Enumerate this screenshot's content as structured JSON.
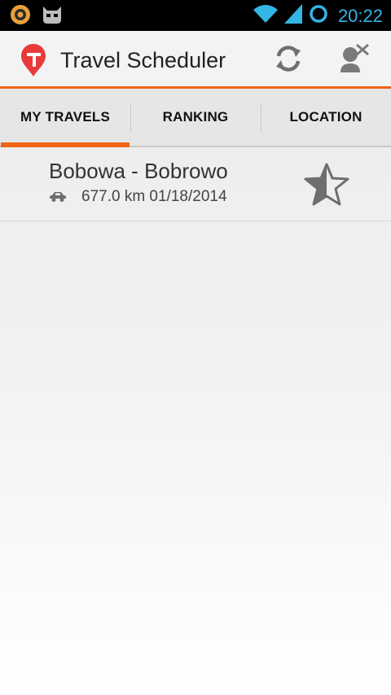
{
  "status_bar": {
    "time": "20:22",
    "icons": [
      "app-notification-icon",
      "cyanogen-mascot-icon",
      "wifi-icon",
      "signal-icon",
      "battery-ring-icon"
    ]
  },
  "action_bar": {
    "title": "Travel Scheduler",
    "logo_icon": "travel-pin-logo-icon",
    "actions": [
      "refresh-icon",
      "user-logout-icon"
    ]
  },
  "tabs": [
    {
      "label": "MY TRAVELS",
      "active": true
    },
    {
      "label": "RANKING",
      "active": false
    },
    {
      "label": "LOCATION",
      "active": false
    }
  ],
  "travels": [
    {
      "route": "Bobowa - Bobrowo",
      "details": "677.0 km 01/18/2014",
      "transport_icon": "car-icon",
      "rating_icon": "half-star-icon"
    }
  ],
  "colors": {
    "accent": "#f06414",
    "status_blue": "#33b5e5"
  }
}
